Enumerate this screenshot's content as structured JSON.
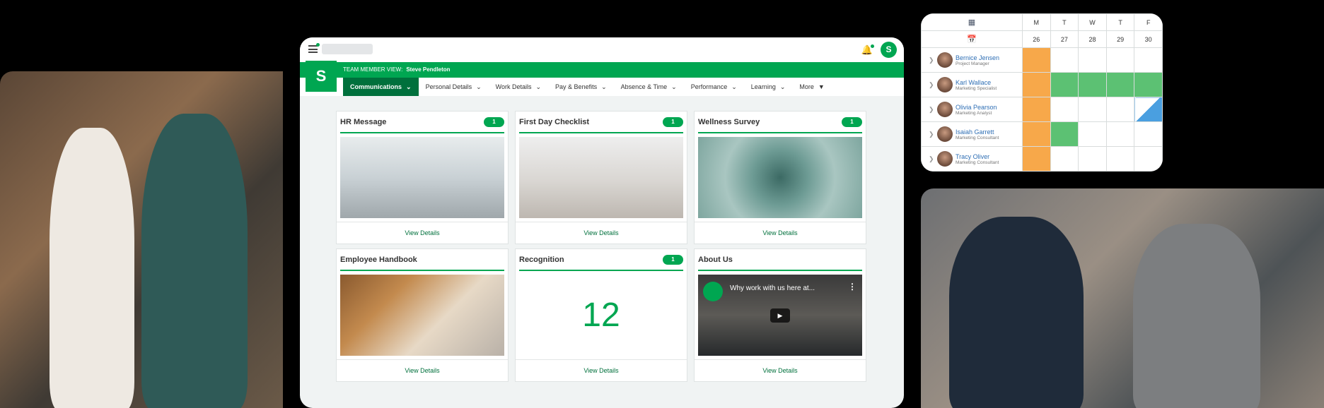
{
  "topbar": {
    "notifications": "notifications",
    "avatar_initial": "S"
  },
  "team_member_bar": {
    "label": "TEAM MEMBER VIEW:",
    "name": "Steve Pendleton"
  },
  "logo_letter": "S",
  "nav": [
    {
      "label": "Communications",
      "active": true
    },
    {
      "label": "Personal Details"
    },
    {
      "label": "Work Details"
    },
    {
      "label": "Pay & Benefits"
    },
    {
      "label": "Absence & Time"
    },
    {
      "label": "Performance"
    },
    {
      "label": "Learning"
    },
    {
      "label": "More"
    }
  ],
  "cards": [
    {
      "title": "HR Message",
      "badge": "1",
      "link": "View Details"
    },
    {
      "title": "First Day Checklist",
      "badge": "1",
      "link": "View Details"
    },
    {
      "title": "Wellness Survey",
      "badge": "1",
      "link": "View Details"
    },
    {
      "title": "Employee Handbook",
      "link": "View Details"
    },
    {
      "title": "Recognition",
      "badge": "1",
      "value": "12",
      "link": "View Details"
    },
    {
      "title": "About Us",
      "video_title": "Why work with us here at...",
      "link": "View Details"
    }
  ],
  "schedule": {
    "days": [
      "M",
      "T",
      "W",
      "T",
      "F"
    ],
    "dates": [
      "26",
      "27",
      "28",
      "29",
      "30"
    ],
    "people": [
      {
        "name": "Bernice Jensen",
        "role": "Project Manager",
        "cells": [
          "or",
          "",
          "",
          "",
          ""
        ]
      },
      {
        "name": "Karl Wallace",
        "role": "Marketing Specialist",
        "cells": [
          "or",
          "gr",
          "gr",
          "gr",
          "gr"
        ]
      },
      {
        "name": "Olivia Pearson",
        "role": "Marketing Analyst",
        "cells": [
          "or",
          "",
          "",
          "",
          "diag"
        ]
      },
      {
        "name": "Isaiah Garrett",
        "role": "Marketing Consultant",
        "cells": [
          "or",
          "gr",
          "",
          "",
          ""
        ]
      },
      {
        "name": "Tracy Oliver",
        "role": "Marketing Consultant",
        "cells": [
          "or",
          "",
          "",
          "",
          ""
        ]
      }
    ],
    "colors": {
      "orange": "#f7a84a",
      "green": "#5cc173",
      "blue": "#4a9fe0"
    }
  },
  "colors": {
    "brand": "#00a651",
    "brand_dark": "#00703c"
  }
}
